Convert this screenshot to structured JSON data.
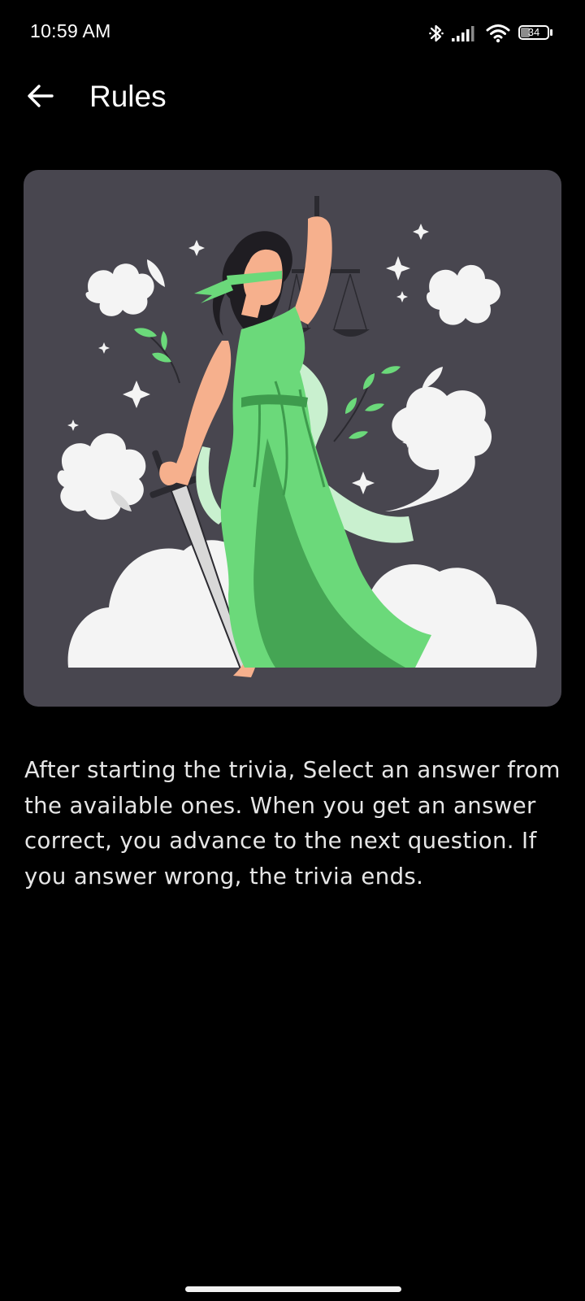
{
  "status_bar": {
    "time": "10:59 AM",
    "battery_level": "34",
    "icons": [
      "bluetooth-icon",
      "signal-icon",
      "wifi-icon",
      "battery-icon"
    ]
  },
  "toolbar": {
    "back_icon": "arrow-left-icon",
    "title": "Rules"
  },
  "illustration": {
    "subject": "lady-justice-illustration",
    "colors": {
      "background": "#48464f",
      "dress": "#6bd97a",
      "dress_shadow": "#3e9b4d",
      "clouds": "#f4f4f4",
      "skin": "#f6b08d",
      "hair": "#1f1d22"
    }
  },
  "rules": {
    "text": "After starting the trivia, Select an answer from the available ones. When you get an answer correct, you advance to the next question. If you answer wrong, the trivia ends."
  },
  "theme": {
    "background": "#000000",
    "text": "#ffffff"
  }
}
